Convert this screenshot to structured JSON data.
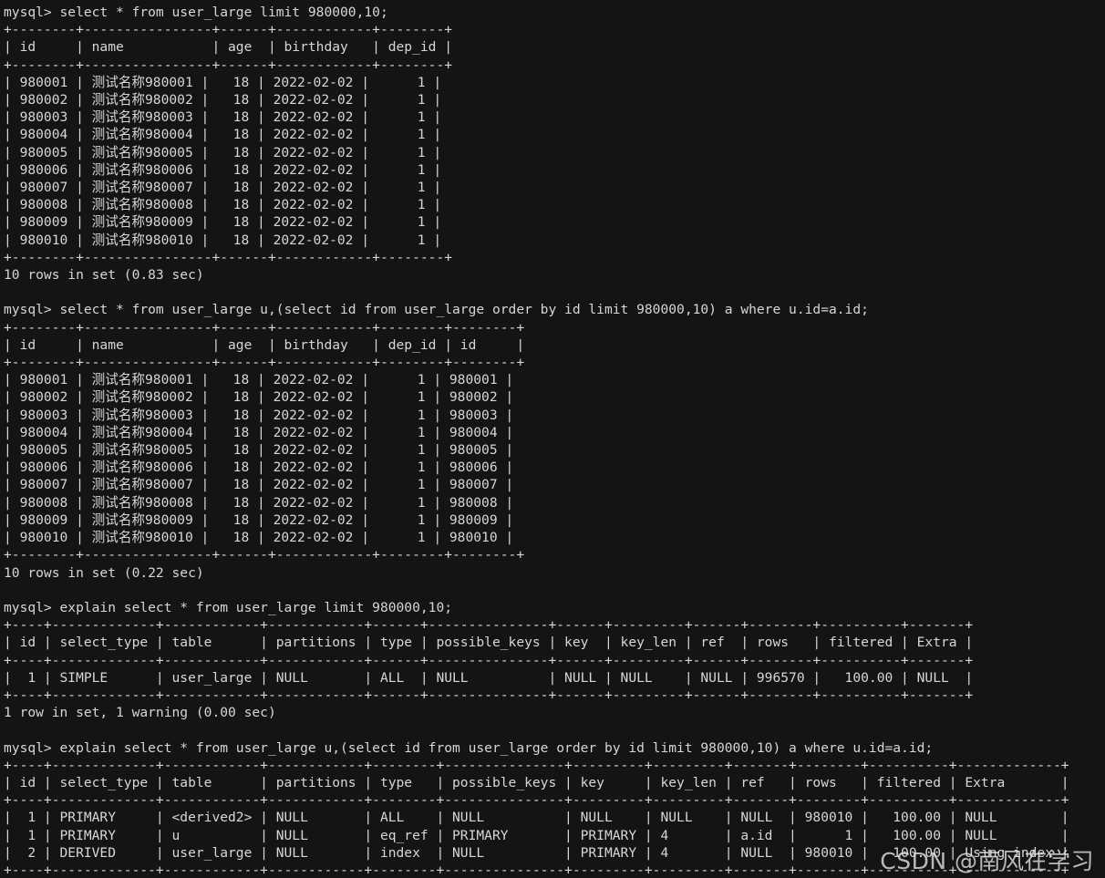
{
  "terminal": {
    "prompt": "mysql> ",
    "background_color": "#141414",
    "foreground_color": "#d7d7d7",
    "watermark": "CSDN @南风在学习"
  },
  "session": {
    "blocks": [
      {
        "name": "query-1-limit-offset",
        "command": "mysql> select * from user_large limit 980000,10;",
        "table": {
          "rule": "+--------+----------------+------+------------+--------+",
          "header": "| id     | name           | age  | birthday   | dep_id |",
          "rows": [
            "| 980001 | 测试名称980001 |   18 | 2022-02-02 |      1 |",
            "| 980002 | 测试名称980002 |   18 | 2022-02-02 |      1 |",
            "| 980003 | 测试名称980003 |   18 | 2022-02-02 |      1 |",
            "| 980004 | 测试名称980004 |   18 | 2022-02-02 |      1 |",
            "| 980005 | 测试名称980005 |   18 | 2022-02-02 |      1 |",
            "| 980006 | 测试名称980006 |   18 | 2022-02-02 |      1 |",
            "| 980007 | 测试名称980007 |   18 | 2022-02-02 |      1 |",
            "| 980008 | 测试名称980008 |   18 | 2022-02-02 |      1 |",
            "| 980009 | 测试名称980009 |   18 | 2022-02-02 |      1 |",
            "| 980010 | 测试名称980010 |   18 | 2022-02-02 |      1 |"
          ]
        },
        "status": "10 rows in set (0.83 sec)"
      },
      {
        "name": "query-2-derived-join",
        "command": "mysql> select * from user_large u,(select id from user_large order by id limit 980000,10) a where u.id=a.id;",
        "table": {
          "rule": "+--------+----------------+------+------------+--------+--------+",
          "header": "| id     | name           | age  | birthday   | dep_id | id     |",
          "rows": [
            "| 980001 | 测试名称980001 |   18 | 2022-02-02 |      1 | 980001 |",
            "| 980002 | 测试名称980002 |   18 | 2022-02-02 |      1 | 980002 |",
            "| 980003 | 测试名称980003 |   18 | 2022-02-02 |      1 | 980003 |",
            "| 980004 | 测试名称980004 |   18 | 2022-02-02 |      1 | 980004 |",
            "| 980005 | 测试名称980005 |   18 | 2022-02-02 |      1 | 980005 |",
            "| 980006 | 测试名称980006 |   18 | 2022-02-02 |      1 | 980006 |",
            "| 980007 | 测试名称980007 |   18 | 2022-02-02 |      1 | 980007 |",
            "| 980008 | 测试名称980008 |   18 | 2022-02-02 |      1 | 980008 |",
            "| 980009 | 测试名称980009 |   18 | 2022-02-02 |      1 | 980009 |",
            "| 980010 | 测试名称980010 |   18 | 2022-02-02 |      1 | 980010 |"
          ]
        },
        "status": "10 rows in set (0.22 sec)"
      },
      {
        "name": "explain-1",
        "command": "mysql> explain select * from user_large limit 980000,10;",
        "table": {
          "rule": "+----+-------------+------------+------------+------+---------------+------+---------+------+--------+----------+-------+",
          "header": "| id | select_type | table      | partitions | type | possible_keys | key  | key_len | ref  | rows   | filtered | Extra |",
          "rows": [
            "|  1 | SIMPLE      | user_large | NULL       | ALL  | NULL          | NULL | NULL    | NULL | 996570 |   100.00 | NULL  |"
          ]
        },
        "status": "1 row in set, 1 warning (0.00 sec)"
      },
      {
        "name": "explain-2",
        "command": "mysql> explain select * from user_large u,(select id from user_large order by id limit 980000,10) a where u.id=a.id;",
        "table": {
          "rule": "+----+-------------+------------+------------+--------+---------------+---------+---------+-------+--------+----------+-------------+",
          "header": "| id | select_type | table      | partitions | type   | possible_keys | key     | key_len | ref   | rows   | filtered | Extra       |",
          "rows": [
            "|  1 | PRIMARY     | <derived2> | NULL       | ALL    | NULL          | NULL    | NULL    | NULL  | 980010 |   100.00 | NULL        |",
            "|  1 | PRIMARY     | u          | NULL       | eq_ref | PRIMARY       | PRIMARY | 4       | a.id  |      1 |   100.00 | NULL        |",
            "|  2 | DERIVED     | user_large | NULL       | index  | NULL          | PRIMARY | 4       | NULL  | 980010 |   100.00 | Using index |"
          ]
        },
        "status": ""
      }
    ]
  }
}
